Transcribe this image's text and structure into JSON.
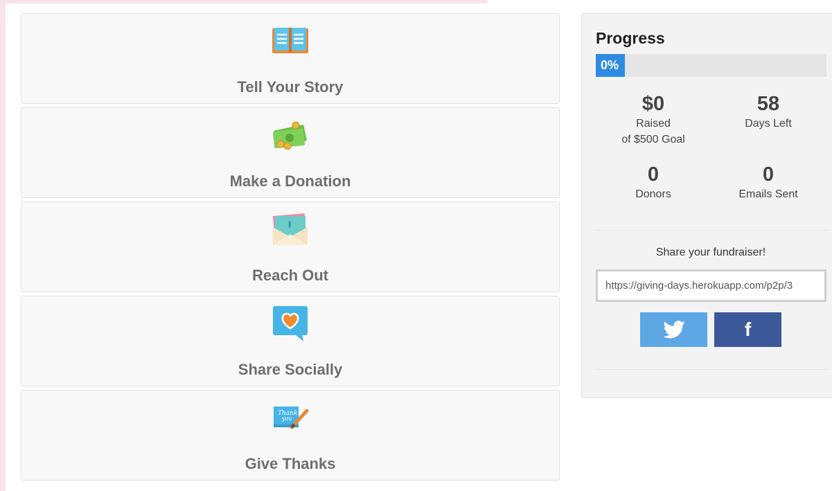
{
  "steps": [
    {
      "label": "Tell Your Story",
      "icon": "book-icon"
    },
    {
      "label": "Make a Donation",
      "icon": "money-icon"
    },
    {
      "label": "Reach Out",
      "icon": "envelope-icon"
    },
    {
      "label": "Share Socially",
      "icon": "heart-bubble-icon"
    },
    {
      "label": "Give Thanks",
      "icon": "thank-you-card-icon"
    }
  ],
  "progress": {
    "title": "Progress",
    "percent_label": "0%",
    "percent": 0,
    "raised": {
      "value": "$0",
      "label": "Raised",
      "sublabel": "of $500 Goal"
    },
    "days_left": {
      "value": "58",
      "label": "Days Left"
    },
    "donors": {
      "value": "0",
      "label": "Donors"
    },
    "emails_sent": {
      "value": "0",
      "label": "Emails Sent"
    }
  },
  "share": {
    "prompt": "Share your fundraiser!",
    "url": "https://giving-days.herokuapp.com/p2p/3",
    "facebook_glyph": "f"
  },
  "colors": {
    "accent": "#2e8be3",
    "twitter": "#5da7e5",
    "facebook": "#3b5998",
    "pink_strip": "#f9e3ea"
  }
}
